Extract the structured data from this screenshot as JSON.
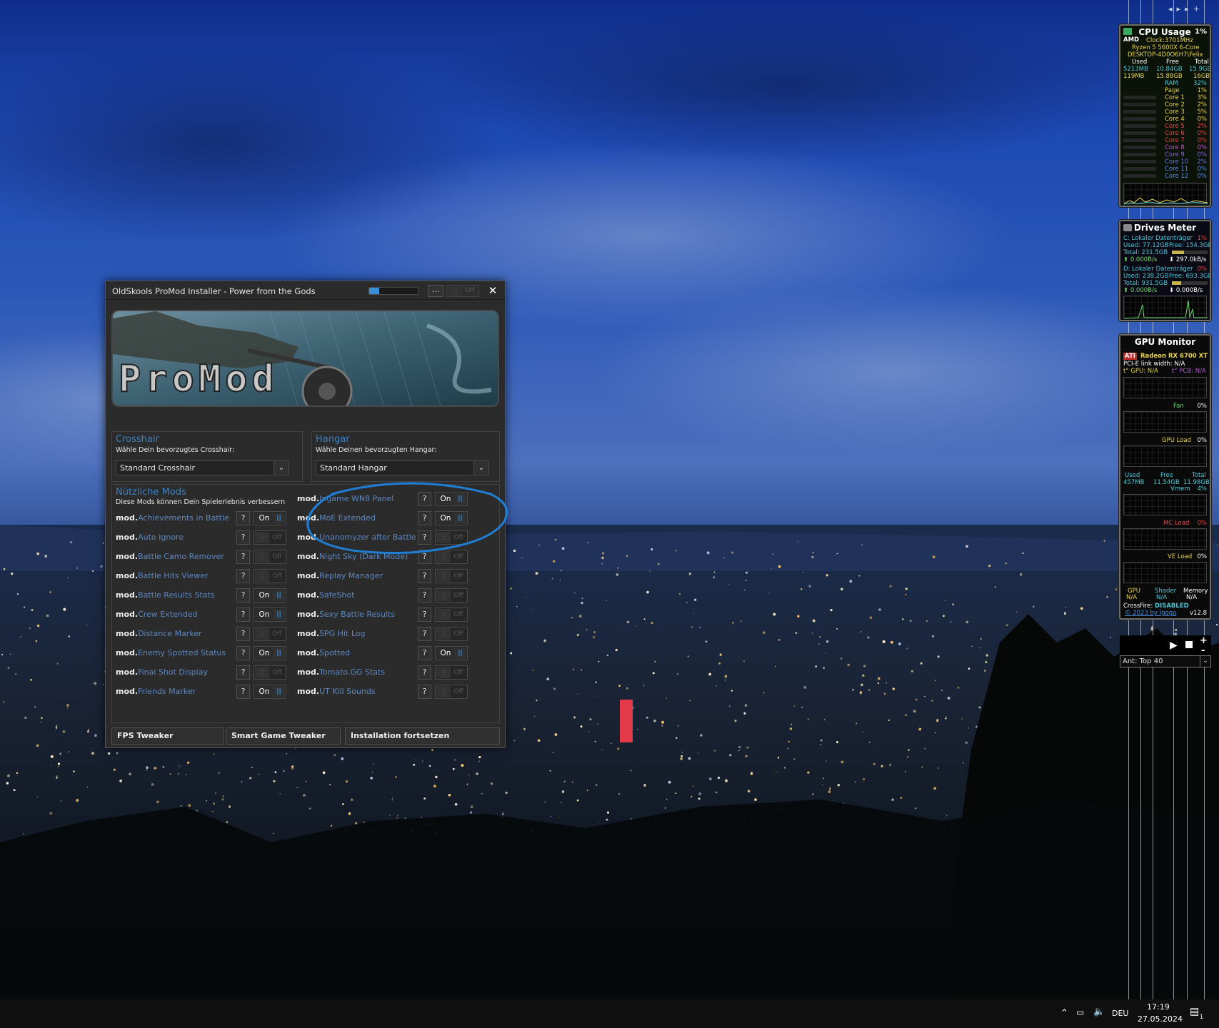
{
  "window": {
    "title": "OldSkools ProMod Installer - Power from the Gods",
    "titlebar_menu_label": "...",
    "titlebar_toggle_off_label": "Off",
    "close_label": "✕",
    "volume_level_percent": 20,
    "banner_logo_text": "ProMod"
  },
  "crosshair": {
    "title": "Crosshair",
    "subtitle": "Wähle Dein bevorzugtes Crosshair:",
    "selected": "Standard Crosshair"
  },
  "hangar": {
    "title": "Hangar",
    "subtitle": "Wähle Deinen bevorzugten Hangar:",
    "selected": "Standard Hangar"
  },
  "mods": {
    "title": "Nützliche Mods",
    "subtitle": "Diese Mods können Dein Spielerlebnis verbessern",
    "prefix": "mod.",
    "help_label": "?",
    "on_label": "On",
    "off_label": "Off",
    "on_knob": "||",
    "off_knob": "||",
    "left": [
      {
        "name": "Achievements in Battle",
        "on": true
      },
      {
        "name": "Auto Ignore",
        "on": false
      },
      {
        "name": "Battle Camo Remover",
        "on": false
      },
      {
        "name": "Battle Hits Viewer",
        "on": false
      },
      {
        "name": "Battle Results Stats",
        "on": true
      },
      {
        "name": "Crew Extended",
        "on": true
      },
      {
        "name": "Distance Marker",
        "on": false
      },
      {
        "name": "Enemy Spotted Status",
        "on": true
      },
      {
        "name": "Final Shot Display",
        "on": false
      },
      {
        "name": "Friends Marker",
        "on": true
      }
    ],
    "right": [
      {
        "name": "Ingame WN8 Panel",
        "on": true
      },
      {
        "name": "MoE Extended",
        "on": true
      },
      {
        "name": "Unanomyzer after Battle",
        "on": false
      },
      {
        "name": "Night Sky (Dark Mode)",
        "on": false
      },
      {
        "name": "Replay Manager",
        "on": false
      },
      {
        "name": "SafeShot",
        "on": false
      },
      {
        "name": "Sexy Battle Results",
        "on": false
      },
      {
        "name": "SPG Hit Log",
        "on": false
      },
      {
        "name": "Spotted",
        "on": true
      },
      {
        "name": "Tomato.GG Stats",
        "on": false
      },
      {
        "name": "UT Kill Sounds",
        "on": false
      }
    ]
  },
  "buttons": {
    "fps": "FPS Tweaker",
    "smart": "Smart Game Tweaker",
    "install": "Installation fortsetzen"
  },
  "cpu_gadget": {
    "title": "CPU Usage",
    "percent": "1%",
    "brand": "AMD",
    "clock": "Clock:3701MHz",
    "cpu_name": "Ryzen 5 5600X 6-Core",
    "host": "DESKTOP-4D0O6H7\\Felix",
    "col_used": "Used",
    "col_free": "Free",
    "col_total": "Total",
    "ram_used": "5213MB",
    "ram_free": "10.84GB",
    "ram_total": "15.9GB",
    "page_used": "119MB",
    "page_free": "15.88GB",
    "page_total": "16GB",
    "ram_label": "RAM",
    "ram_pct": "32%",
    "page_label": "Page",
    "page_pct": "1%",
    "cores": [
      {
        "label": "Core 1",
        "pct": "3%"
      },
      {
        "label": "Core 2",
        "pct": "2%"
      },
      {
        "label": "Core 3",
        "pct": "5%"
      },
      {
        "label": "Core 4",
        "pct": "0%"
      },
      {
        "label": "Core 5",
        "pct": "2%"
      },
      {
        "label": "Core 6",
        "pct": "0%"
      },
      {
        "label": "Core 7",
        "pct": "0%"
      },
      {
        "label": "Core 8",
        "pct": "0%"
      },
      {
        "label": "Core 9",
        "pct": "0%"
      },
      {
        "label": "Core 10",
        "pct": "2%"
      },
      {
        "label": "Core 11",
        "pct": "0%"
      },
      {
        "label": "Core 12",
        "pct": "0%"
      }
    ]
  },
  "drives_gadget": {
    "title": "Drives Meter",
    "c_name": "C: Lokaler Datenträger",
    "c_pct": "1%",
    "c_used": "Used: 77.12GB",
    "c_free": "Free: 154.3GB",
    "c_total": "Total: 231.5GB",
    "c_read": "⬆ 0.000B/s",
    "c_write": "⬇ 297.0kB/s",
    "d_name": "D: Lokaler Datenträger",
    "d_pct": "0%",
    "d_used": "Used: 238.2GB",
    "d_free": "Free: 693.3GB",
    "d_total": "Total: 931.5GB",
    "d_read": "⬆ 0.000B/s",
    "d_write": "⬇ 0.000B/s",
    "c_fill_percent": 33,
    "d_fill_percent": 26
  },
  "gpu_gadget": {
    "title": "GPU Monitor",
    "brand": "ATI",
    "gpu_name": "Radeon RX 6700 XT",
    "pcie": "PCI-E link width: N/A",
    "temp_gpu": "t° GPU: N/A",
    "temp_pcb": "t° PCB: N/A",
    "fan_label": "Fan",
    "fan_pct": "0%",
    "load_label": "GPU Load",
    "load_pct": "0%",
    "col_used": "Used",
    "col_free": "Free",
    "col_total": "Total",
    "mem_used": "457MB",
    "mem_free": "11.54GB",
    "mem_total": "11.98GB",
    "vmem_label": "Vmem",
    "vmem_pct": "4%",
    "mc_label": "MC Load",
    "mc_pct": "0%",
    "ve_label": "VE Load",
    "ve_pct": "0%",
    "clk_gpu": "GPU",
    "clk_shader": "Shader",
    "clk_memory": "Memory",
    "clk_gpu_val": "N/A",
    "clk_shader_val": "N/A",
    "clk_memory_val": "N/A",
    "crossfire_label": "CrossFire:",
    "crossfire_value": "DISABLED",
    "credit": "© 2023 by Igogo",
    "version": "v12.8"
  },
  "media": {
    "station": "Ant: Top 40"
  },
  "taskbar": {
    "lang": "DEU",
    "time": "17:19",
    "date": "27.05.2024",
    "notif_count": "1"
  },
  "colors": {
    "accent": "#3b82c6",
    "mod_name": "#5b86bf",
    "window_bg": "#2b2b2b",
    "annotation_circle": "#1f7fd6"
  }
}
